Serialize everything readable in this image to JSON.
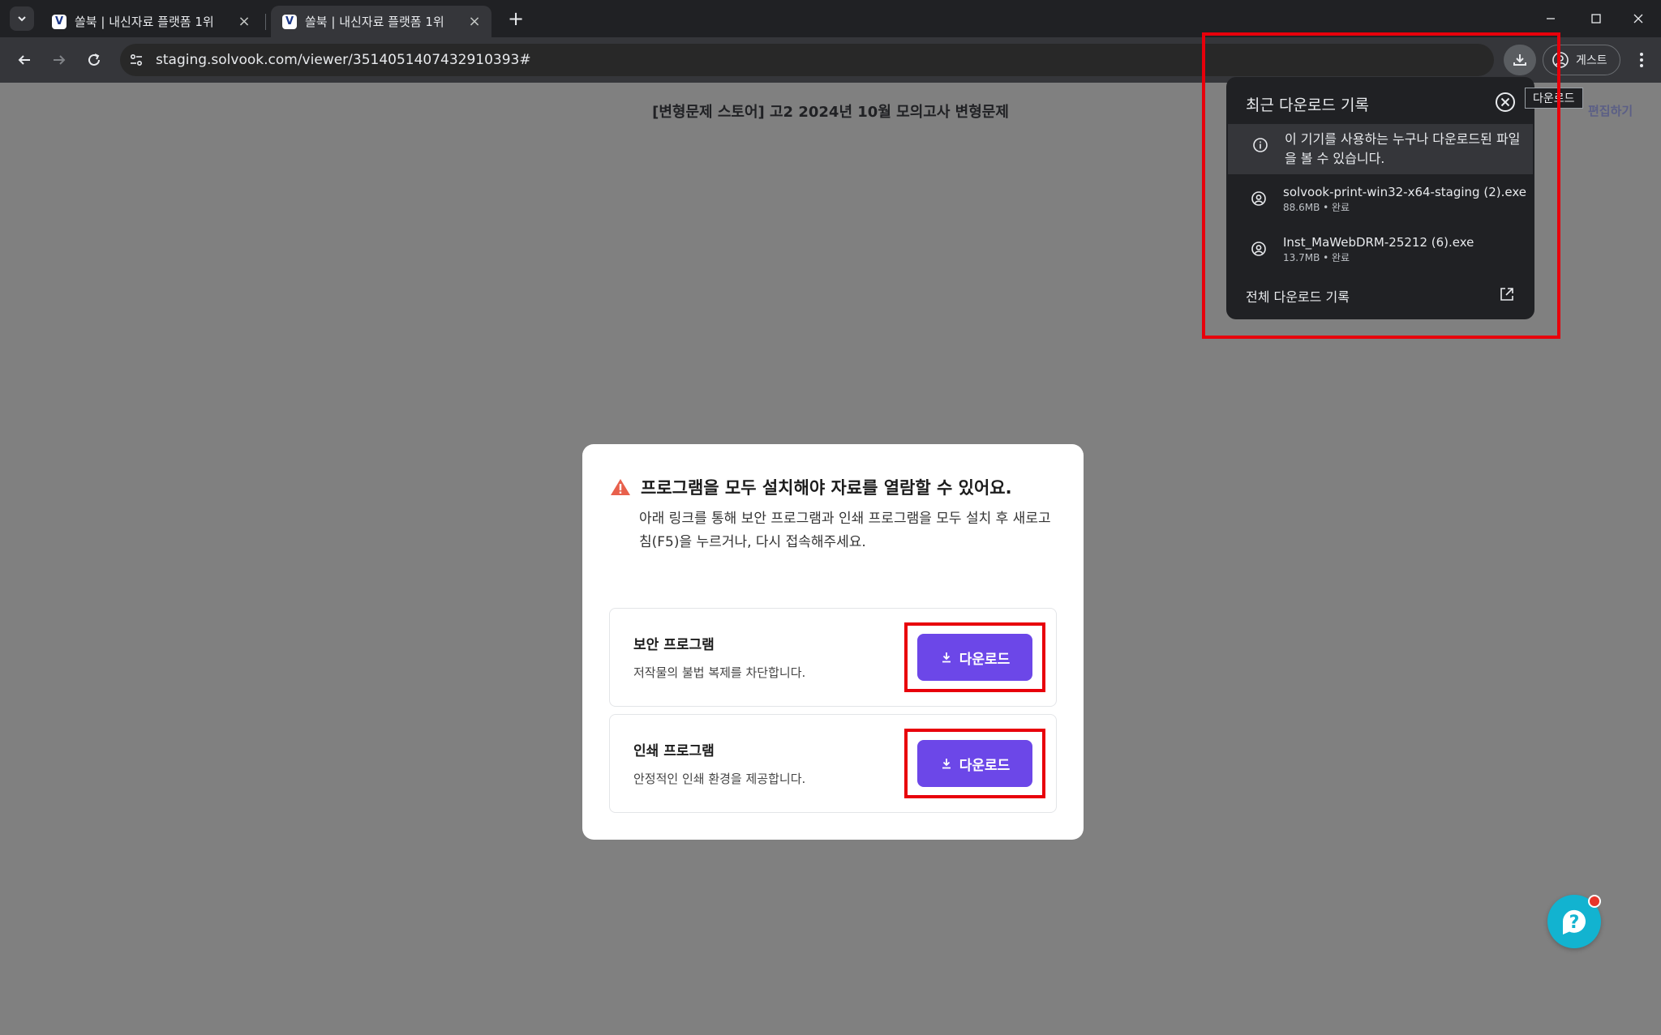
{
  "browser": {
    "tabs": [
      {
        "title": "쏠북 | 내신자료 플랫폼 1위",
        "favicon": "V",
        "active": false
      },
      {
        "title": "쏠북 | 내신자료 플랫폼 1위",
        "favicon": "V",
        "active": true
      }
    ],
    "new_tab_label": "+",
    "url": "staging.solvook.com/viewer/3514051407432910393#",
    "guest_label": "게스트",
    "download_tooltip": "다운로드"
  },
  "page": {
    "title": "[변형문제 스토어] 고2 2024년 10월 모의고사 변형문제",
    "edit_label": "편집하기"
  },
  "modal": {
    "title": "프로그램을 모두 설치해야 자료를 열람할 수 있어요.",
    "description": "아래 링크를 통해 보안 프로그램과 인쇄 프로그램을 모두 설치 후 새로고침(F5)을 누르거나, 다시 접속해주세요.",
    "programs": [
      {
        "name": "보안 프로그램",
        "description": "저작물의 불법 복제를 차단합니다.",
        "button_label": "다운로드"
      },
      {
        "name": "인쇄 프로그램",
        "description": "안정적인 인쇄 환경을 제공합니다.",
        "button_label": "다운로드"
      }
    ]
  },
  "downloads_panel": {
    "title": "최근 다운로드 기록",
    "privacy_notice": "이 기기를 사용하는 누구나 다운로드된 파일을 볼 수 있습니다.",
    "items": [
      {
        "name": "solvook-print-win32-x64-staging (2).exe",
        "meta": "88.6MB • 완료"
      },
      {
        "name": "Inst_MaWebDRM-25212 (6).exe",
        "meta": "13.7MB • 완료"
      }
    ],
    "all_history_label": "전체 다운로드 기록"
  },
  "colors": {
    "accent": "#6c47e8",
    "highlight": "#e8000b",
    "warning": "#e8604c",
    "help": "#12b3d0"
  },
  "icons": [
    "tab-search-icon",
    "close-icon",
    "back-icon",
    "forward-icon",
    "reload-icon",
    "site-info-icon",
    "download-icon",
    "guest-icon",
    "kebab-menu-icon",
    "warning-icon",
    "info-icon",
    "file-icon",
    "external-link-icon",
    "help-icon"
  ]
}
